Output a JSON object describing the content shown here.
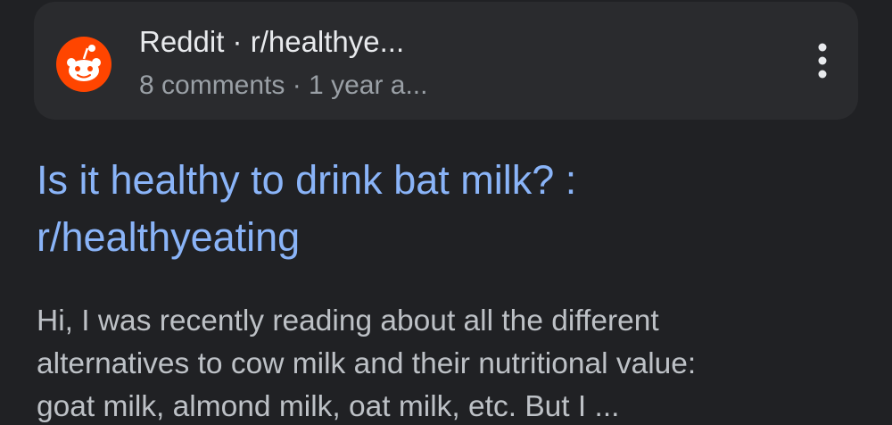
{
  "result": {
    "source": {
      "name": "Reddit · r/healthye...",
      "meta": "8 comments · 1 year a...",
      "icon": "reddit-logo",
      "brand_color": "#ff4500",
      "menu_icon": "more-vert-icon"
    },
    "title_line1": "Is it healthy to drink bat milk? :",
    "title_line2": "r/healthyeating",
    "snippet_line1": "Hi, I was recently reading about all the different",
    "snippet_line2": "alternatives to cow milk and their nutritional value:",
    "snippet_line3": "goat milk, almond milk, oat milk, etc. But I ..."
  },
  "colors": {
    "background": "#202124",
    "card": "#2a2b2e",
    "link": "#8ab4f8",
    "primary_text": "#e8eaed",
    "secondary_text": "#9aa0a6",
    "snippet_text": "#bdc1c6"
  }
}
